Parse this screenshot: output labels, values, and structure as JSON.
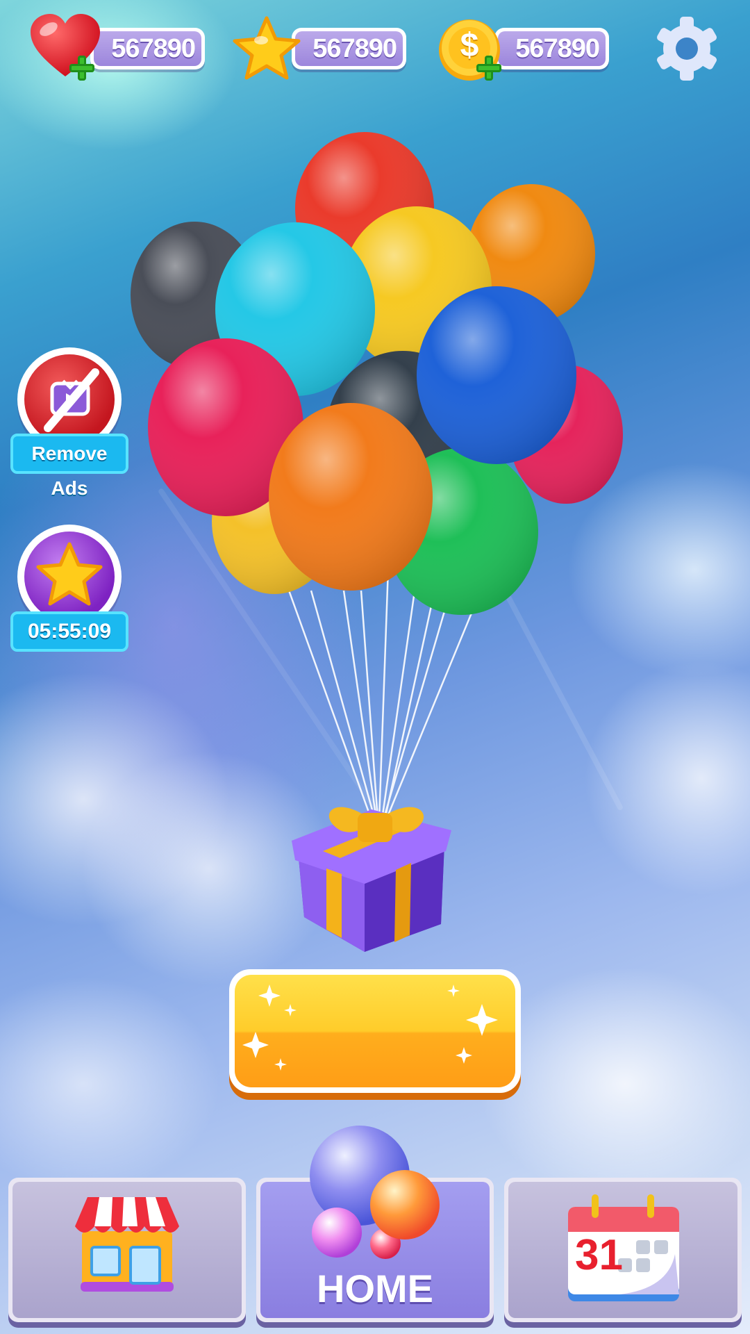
{
  "top_bar": {
    "lives": {
      "value": "567890",
      "icon": "heart-icon"
    },
    "stars": {
      "value": "567890",
      "icon": "star-icon"
    },
    "coins": {
      "value": "567890",
      "icon": "coin-icon",
      "symbol": "$"
    },
    "settings": {
      "icon": "gear-icon"
    }
  },
  "side_buttons": {
    "remove_ads": {
      "label": "Remove Ads",
      "icon": "no-ads-icon"
    },
    "star_event": {
      "timer": "05:55:09",
      "icon": "star-bubble-icon"
    }
  },
  "hero": {
    "icon": "gift-with-balloons"
  },
  "main_button": {
    "label": ""
  },
  "bottom_nav": {
    "shop": {
      "icon": "shop-icon"
    },
    "home": {
      "label": "HOME",
      "icon": "bubbles-icon"
    },
    "calendar": {
      "icon": "calendar-icon",
      "day": "31"
    }
  },
  "colors": {
    "accent_purple": "#9c86dc",
    "button_yellow": "#ffc62a",
    "label_blue": "#1bb9f0",
    "plus_green": "#3cbf2e"
  }
}
